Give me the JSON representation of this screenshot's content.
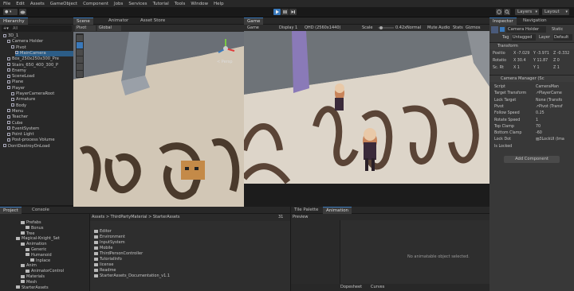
{
  "menu": [
    "File",
    "Edit",
    "Assets",
    "GameObject",
    "Component",
    "Jobs",
    "Services",
    "Tutorial",
    "Tools",
    "Window",
    "Help"
  ],
  "toolbar": {
    "account_label": "● ▾",
    "layers_label": "Layers",
    "layout_label": "Layout"
  },
  "hierarchy": {
    "tab_label": "Hierarchy",
    "search_placeholder": "All",
    "items": [
      {
        "label": "3D_1",
        "indent": 0
      },
      {
        "label": "Camera Holder",
        "indent": 1
      },
      {
        "label": "Pivot",
        "indent": 2
      },
      {
        "label": "MainCamera",
        "indent": 3
      },
      {
        "label": "Box_250x250x300_Pre",
        "indent": 1
      },
      {
        "label": "Stairs_650_400_300_P",
        "indent": 1
      },
      {
        "label": "Enemy",
        "indent": 1
      },
      {
        "label": "SceneLoad",
        "indent": 1
      },
      {
        "label": "Plane",
        "indent": 1
      },
      {
        "label": "Player",
        "indent": 1
      },
      {
        "label": "PlayerCameraRoot",
        "indent": 2
      },
      {
        "label": "Armature",
        "indent": 2
      },
      {
        "label": "Body",
        "indent": 2
      },
      {
        "label": "Menu",
        "indent": 1
      },
      {
        "label": "Teacher",
        "indent": 1
      },
      {
        "label": "Cube",
        "indent": 1
      },
      {
        "label": "EventSystem",
        "indent": 1
      },
      {
        "label": "Point Light",
        "indent": 1
      },
      {
        "label": "Post-process Volume",
        "indent": 1
      },
      {
        "label": "DontDestroyOnLoad",
        "indent": 0
      }
    ]
  },
  "scene": {
    "tabs": [
      "Scene",
      "Animator",
      "Asset Store"
    ],
    "pivot_label": "Pivot",
    "global_label": "Global",
    "persp_label": "< Persp"
  },
  "game": {
    "tab_label": "Game",
    "display_label": "Game",
    "display_select": "Display 1",
    "resolution": "QHD (2560x1440)",
    "scale_label": "Scale",
    "scale_value": "0.42x",
    "normal_label": "Normal",
    "mute_label": "Mute Audio",
    "stats_label": "Stats",
    "gizmos_label": "Gizmos"
  },
  "inspector": {
    "tabs": [
      "Inspector",
      "Navigation"
    ],
    "object_name": "Camera Holder",
    "static_label": "Static",
    "tag_label": "Tag",
    "tag_value": "Untagged",
    "layer_label": "Layer",
    "layer_value": "Default",
    "transform_label": "Transform",
    "position_label": "Positio",
    "position": [
      "X -7.029",
      "Y -3.971",
      "Z -0.332"
    ],
    "rotation_label": "Rotatio",
    "rotation": [
      "X 30.4",
      "Y 11.87",
      "Z 0"
    ],
    "scale_label": "Sc. Rt",
    "scale": [
      "X 1",
      "Y 1",
      "Z 1"
    ],
    "component_label": "Camera Manager (Sc",
    "fields": [
      {
        "label": "Script",
        "value": "CameraMan"
      },
      {
        "label": "Target Transform",
        "value": "↗PlayerCame"
      },
      {
        "label": "Lock Target",
        "value": "None (Transfo"
      },
      {
        "label": "Pivot",
        "value": "↗Pivot (Transf"
      },
      {
        "label": "Follow Speed",
        "value": "0.25"
      },
      {
        "label": "Rotate Speed",
        "value": "1"
      },
      {
        "label": "Top Clamp",
        "value": "70"
      },
      {
        "label": "Bottom Clamp",
        "value": "-60"
      },
      {
        "label": "Lock Dot",
        "value": "▨3LockUI (Ima"
      },
      {
        "label": "Is Locked",
        "value": ""
      }
    ],
    "add_component_label": "Add Component"
  },
  "project": {
    "tabs": [
      "Project",
      "Console"
    ],
    "tree": [
      {
        "label": "Prefabs",
        "indent": 1
      },
      {
        "label": "Bonus",
        "indent": 2
      },
      {
        "label": "Tree",
        "indent": 1
      },
      {
        "label": "Magical-Knight_Set",
        "indent": 0
      },
      {
        "label": "Animation",
        "indent": 1
      },
      {
        "label": "Generic",
        "indent": 2
      },
      {
        "label": "Humanoid",
        "indent": 2
      },
      {
        "label": "Inplace",
        "indent": 3
      },
      {
        "label": "Anim",
        "indent": 1
      },
      {
        "label": "AnimatorControl",
        "indent": 2
      },
      {
        "label": "Materials",
        "indent": 1
      },
      {
        "label": "Mesh",
        "indent": 1
      },
      {
        "label": "StarterAssets",
        "indent": 0
      }
    ],
    "breadcrumb": "Assets > ThirdPartyMaterial > StarterAssets",
    "count_label": "31",
    "files": [
      "Editor",
      "Environment",
      "InputSystem",
      "Mobile",
      "ThirdPersonController",
      "TutorialInfo",
      "license",
      "Readme",
      "StarterAssets_Documentation_v1.1"
    ]
  },
  "animation": {
    "tabs": [
      "Tile Palette",
      "Animation"
    ],
    "preview_label": "Preview",
    "empty_message": "No animatable object selected.",
    "dopesheet_label": "Dopesheet",
    "curves_label": "Curves"
  },
  "colors": {
    "accent": "#3a79bb",
    "panel": "#383838",
    "dark": "#191919"
  }
}
